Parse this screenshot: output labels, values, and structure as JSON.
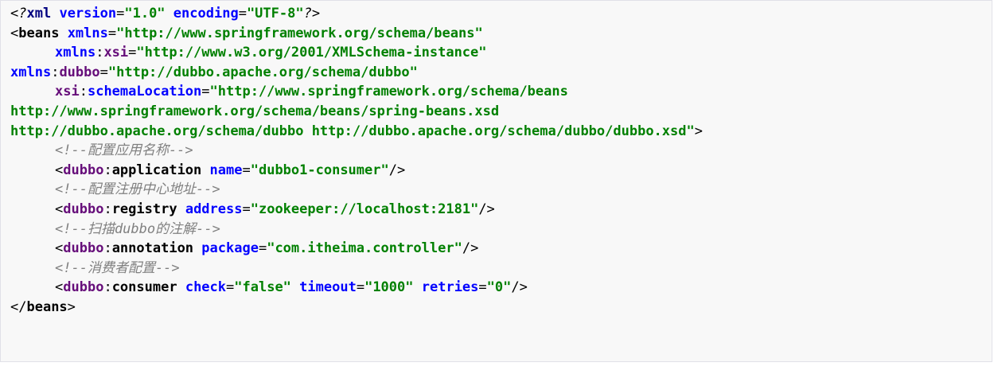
{
  "lines": [
    {
      "parts": [
        {
          "t": "<?",
          "c": "pi"
        },
        {
          "t": "xml",
          "c": "kw"
        },
        {
          "t": " ",
          "c": "punc"
        },
        {
          "t": "version",
          "c": "attr"
        },
        {
          "t": "=",
          "c": "punc"
        },
        {
          "t": "\"1.0\"",
          "c": "val"
        },
        {
          "t": " ",
          "c": "punc"
        },
        {
          "t": "encoding",
          "c": "attr"
        },
        {
          "t": "=",
          "c": "punc"
        },
        {
          "t": "\"UTF-8\"",
          "c": "val"
        },
        {
          "t": "?>",
          "c": "pi"
        }
      ]
    },
    {
      "parts": [
        {
          "t": "<",
          "c": "punc"
        },
        {
          "t": "beans",
          "c": "tag"
        },
        {
          "t": " ",
          "c": "punc"
        },
        {
          "t": "xmlns",
          "c": "attr"
        },
        {
          "t": "=",
          "c": "punc"
        },
        {
          "t": "\"http://www.springframework.org/schema/beans\"",
          "c": "val"
        }
      ]
    },
    {
      "indent": true,
      "parts": [
        {
          "t": "xmlns",
          "c": "attr"
        },
        {
          "t": ":",
          "c": "punc"
        },
        {
          "t": "xsi",
          "c": "ns"
        },
        {
          "t": "=",
          "c": "punc"
        },
        {
          "t": "\"http://www.w3.org/2001/XMLSchema-instance\"",
          "c": "val"
        }
      ]
    },
    {
      "parts": [
        {
          "t": "xmlns",
          "c": "attr"
        },
        {
          "t": ":",
          "c": "punc"
        },
        {
          "t": "dubbo",
          "c": "ns"
        },
        {
          "t": "=",
          "c": "punc"
        },
        {
          "t": "\"http://dubbo.apache.org/schema/dubbo\"",
          "c": "val"
        }
      ]
    },
    {
      "indent": true,
      "parts": [
        {
          "t": "xsi",
          "c": "ns"
        },
        {
          "t": ":",
          "c": "punc"
        },
        {
          "t": "schemaLocation",
          "c": "attr"
        },
        {
          "t": "=",
          "c": "punc"
        },
        {
          "t": "\"http://www.springframework.org/schema/beans",
          "c": "val"
        }
      ]
    },
    {
      "parts": [
        {
          "t": "http://www.springframework.org/schema/beans/spring-beans.xsd",
          "c": "val"
        }
      ]
    },
    {
      "parts": [
        {
          "t": "http://dubbo.apache.org/schema/dubbo http://dubbo.apache.org/schema/dubbo/dubbo.xsd\"",
          "c": "val"
        },
        {
          "t": ">",
          "c": "punc"
        }
      ]
    },
    {
      "indent": true,
      "parts": [
        {
          "t": "<!--配置应用名称-->",
          "c": "comment"
        }
      ]
    },
    {
      "indent": true,
      "parts": [
        {
          "t": "<",
          "c": "punc"
        },
        {
          "t": "dubbo",
          "c": "ns"
        },
        {
          "t": ":",
          "c": "punc"
        },
        {
          "t": "application",
          "c": "tag"
        },
        {
          "t": " ",
          "c": "punc"
        },
        {
          "t": "name",
          "c": "attr"
        },
        {
          "t": "=",
          "c": "punc"
        },
        {
          "t": "\"dubbo1-consumer\"",
          "c": "val"
        },
        {
          "t": "/>",
          "c": "punc"
        }
      ]
    },
    {
      "indent": true,
      "parts": [
        {
          "t": "<!--配置注册中心地址-->",
          "c": "comment"
        }
      ]
    },
    {
      "indent": true,
      "parts": [
        {
          "t": "<",
          "c": "punc"
        },
        {
          "t": "dubbo",
          "c": "ns"
        },
        {
          "t": ":",
          "c": "punc"
        },
        {
          "t": "registry",
          "c": "tag"
        },
        {
          "t": " ",
          "c": "punc"
        },
        {
          "t": "address",
          "c": "attr"
        },
        {
          "t": "=",
          "c": "punc"
        },
        {
          "t": "\"zookeeper://localhost:2181\"",
          "c": "val"
        },
        {
          "t": "/>",
          "c": "punc"
        }
      ]
    },
    {
      "indent": true,
      "parts": [
        {
          "t": "<!--扫描dubbo的注解-->",
          "c": "comment"
        }
      ]
    },
    {
      "indent": true,
      "parts": [
        {
          "t": "<",
          "c": "punc"
        },
        {
          "t": "dubbo",
          "c": "ns"
        },
        {
          "t": ":",
          "c": "punc"
        },
        {
          "t": "annotation",
          "c": "tag"
        },
        {
          "t": " ",
          "c": "punc"
        },
        {
          "t": "package",
          "c": "attr"
        },
        {
          "t": "=",
          "c": "punc"
        },
        {
          "t": "\"com.itheima.controller\"",
          "c": "val"
        },
        {
          "t": "/>",
          "c": "punc"
        }
      ]
    },
    {
      "indent": true,
      "parts": [
        {
          "t": "<!--消费者配置-->",
          "c": "comment"
        }
      ]
    },
    {
      "indent": true,
      "parts": [
        {
          "t": "<",
          "c": "punc"
        },
        {
          "t": "dubbo",
          "c": "ns"
        },
        {
          "t": ":",
          "c": "punc"
        },
        {
          "t": "consumer",
          "c": "tag"
        },
        {
          "t": " ",
          "c": "punc"
        },
        {
          "t": "check",
          "c": "attr"
        },
        {
          "t": "=",
          "c": "punc"
        },
        {
          "t": "\"false\"",
          "c": "val"
        },
        {
          "t": " ",
          "c": "punc"
        },
        {
          "t": "timeout",
          "c": "attr"
        },
        {
          "t": "=",
          "c": "punc"
        },
        {
          "t": "\"1000\"",
          "c": "val"
        },
        {
          "t": " ",
          "c": "punc"
        },
        {
          "t": "retries",
          "c": "attr"
        },
        {
          "t": "=",
          "c": "punc"
        },
        {
          "t": "\"0\"",
          "c": "val"
        },
        {
          "t": "/>",
          "c": "punc"
        }
      ]
    },
    {
      "parts": [
        {
          "t": "</",
          "c": "punc"
        },
        {
          "t": "beans",
          "c": "tag"
        },
        {
          "t": ">",
          "c": "punc"
        }
      ]
    }
  ]
}
